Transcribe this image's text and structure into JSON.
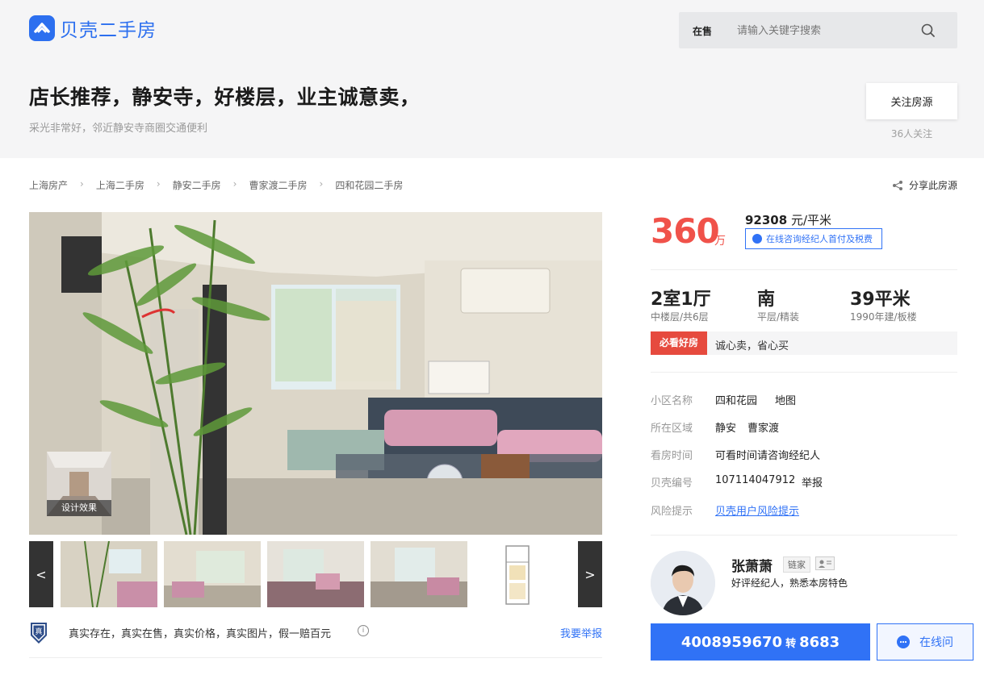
{
  "header": {
    "logo_text": "贝壳二手房",
    "search_tab": "在售",
    "search_placeholder": "请输入关键字搜索"
  },
  "listing": {
    "title": "店长推荐，静安寺，好楼层，业主诚意卖，",
    "subtitle": "采光非常好，邻近静安寺商圈交通便利",
    "follow_label": "关注房源",
    "follow_count": "36人关注"
  },
  "breadcrumb": [
    "上海房产",
    "上海二手房",
    "静安二手房",
    "曹家渡二手房",
    "四和花园二手房"
  ],
  "share_label": "分享此房源",
  "gallery": {
    "design_label": "设计效果",
    "prev_label": "<",
    "next_label": ">"
  },
  "guarantee": {
    "badge": "真",
    "text": "真实存在，真实在售，真实价格，真实图片，假一赔百元",
    "info": "i",
    "report": "我要举报"
  },
  "price": {
    "total": "360",
    "total_unit": "万",
    "unit_value": "92308",
    "unit_suffix": " 元/平米",
    "consult": "在线咨询经纪人首付及税费"
  },
  "specs": [
    {
      "main": "2室1厅",
      "sub": "中楼层/共6层"
    },
    {
      "main": "南",
      "sub": "平层/精装"
    },
    {
      "main": "39平米",
      "sub": "1990年建/板楼"
    }
  ],
  "must_see": {
    "tag": "必看好房",
    "text": "诚心卖，省心买"
  },
  "info": [
    {
      "label": "小区名称",
      "value": "四和花园",
      "extra": "地图"
    },
    {
      "label": "所在区域",
      "value": "静安",
      "extra": "曹家渡"
    },
    {
      "label": "看房时间",
      "value": "可看时间请咨询经纪人",
      "extra": ""
    },
    {
      "label": "贝壳编号",
      "value": "107114047912",
      "extra": "举报"
    },
    {
      "label": "风险提示",
      "value": "贝壳用户风险提示",
      "extra": ""
    }
  ],
  "agent": {
    "name": "张萧萧",
    "company": "链家",
    "desc": "好评经纪人，熟悉本房特色",
    "phone": "4008959670",
    "zhuan": "转",
    "ext": "8683",
    "online": "在线问"
  },
  "colors": {
    "brand": "#2c6fef",
    "price": "#f0524a",
    "link": "#3072f6",
    "tag_red": "#e64a3e"
  }
}
